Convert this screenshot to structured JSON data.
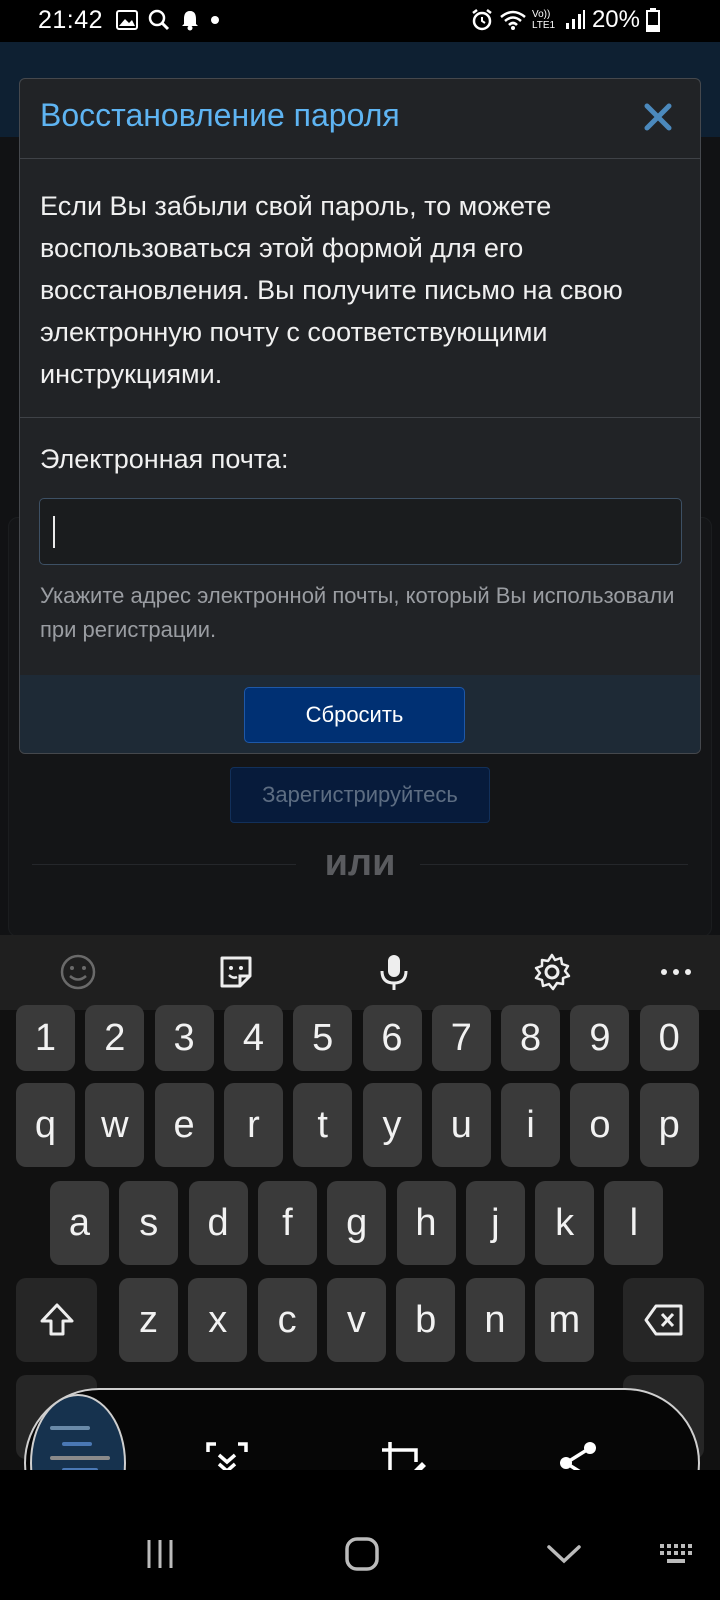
{
  "status_bar": {
    "time": "21:42",
    "battery_percent": "20%",
    "left_icons": [
      "image-icon",
      "search-icon",
      "bell-icon",
      "dot-icon"
    ],
    "right_icons": [
      "alarm-icon",
      "wifi-icon",
      "volte-icon",
      "signal-icon",
      "battery-icon"
    ],
    "volte_label": "Vo)) LTE1"
  },
  "background": {
    "register_button": "Зарегистрируйтесь",
    "or_text": "или"
  },
  "modal": {
    "title": "Восстановление пароля",
    "description": "Если Вы забыли свой пароль, то можете воспользоваться этой формой для его восстановления. Вы получите письмо на свою электронную почту с соответствующими инструкциями.",
    "email_label": "Электронная почта:",
    "email_value": "",
    "email_hint": "Укажите адрес электронной почты, который Вы использовали при регистрации.",
    "reset_button": "Сбросить"
  },
  "keyboard": {
    "toolbar": [
      "emoji-icon",
      "sticker-icon",
      "microphone-icon",
      "settings-gear-icon",
      "more-icon"
    ],
    "rows": [
      [
        "1",
        "2",
        "3",
        "4",
        "5",
        "6",
        "7",
        "8",
        "9",
        "0"
      ],
      [
        "q",
        "w",
        "e",
        "r",
        "t",
        "y",
        "u",
        "i",
        "o",
        "p"
      ],
      [
        "a",
        "s",
        "d",
        "f",
        "g",
        "h",
        "j",
        "k",
        "l"
      ],
      [
        "z",
        "x",
        "c",
        "v",
        "b",
        "n",
        "m"
      ]
    ]
  },
  "screenshot_toolbar": {
    "icons": [
      "scroll-capture-icon",
      "crop-edit-icon",
      "share-icon"
    ]
  },
  "nav_bar": {
    "icons": [
      "recents-icon",
      "home-icon",
      "back-icon",
      "keyboard-switch-icon"
    ]
  }
}
